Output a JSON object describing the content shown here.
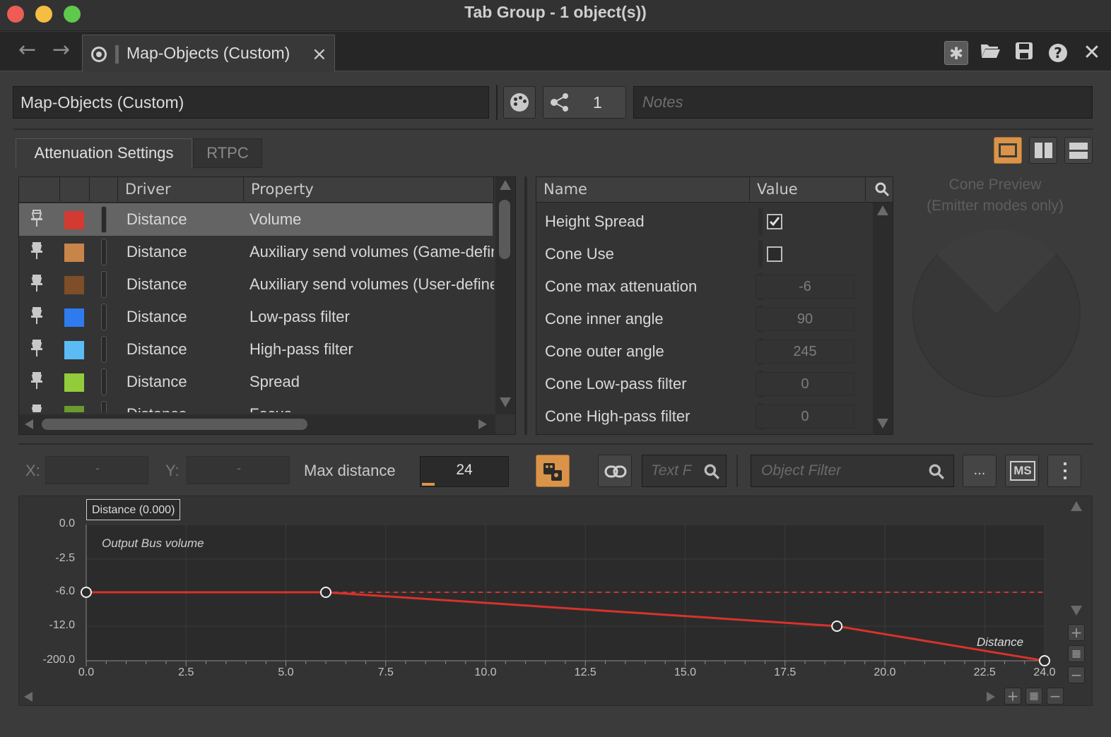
{
  "window": {
    "title": "Tab Group - 1 object(s))",
    "traffic_colors": [
      "#ee5c55",
      "#f5bd42",
      "#5ec94a"
    ]
  },
  "doc_tab": {
    "label": "Map-Objects (Custom)",
    "close": "×"
  },
  "object": {
    "name": "Map-Objects (Custom)",
    "share_count": "1",
    "notes_placeholder": "Notes"
  },
  "tabs": [
    {
      "label": "Attenuation Settings",
      "active": true
    },
    {
      "label": "RTPC",
      "active": false
    }
  ],
  "curve_table": {
    "columns": [
      "",
      "",
      "",
      "Driver",
      "Property"
    ],
    "rows": [
      {
        "driver": "Distance",
        "property": "Volume",
        "color": "#d33a32",
        "selected": true
      },
      {
        "driver": "Distance",
        "property": "Auxiliary send volumes (Game-defined)",
        "color": "#c8854a",
        "selected": false
      },
      {
        "driver": "Distance",
        "property": "Auxiliary send volumes (User-defined)",
        "color": "#7d4e27",
        "selected": false
      },
      {
        "driver": "Distance",
        "property": "Low-pass filter",
        "color": "#2e7bf0",
        "selected": false
      },
      {
        "driver": "Distance",
        "property": "High-pass filter",
        "color": "#5bbcf5",
        "selected": false
      },
      {
        "driver": "Distance",
        "property": "Spread",
        "color": "#93cc3b",
        "selected": false
      },
      {
        "driver": "Distance",
        "property": "Focus",
        "color": "#6b9a2e",
        "selected": false
      }
    ]
  },
  "properties": {
    "columns": [
      "Name",
      "Value"
    ],
    "rows": [
      {
        "name": "Height Spread",
        "type": "checkbox",
        "checked": true
      },
      {
        "name": "Cone Use",
        "type": "checkbox",
        "checked": false
      },
      {
        "name": "Cone max attenuation",
        "type": "value",
        "value": "-6"
      },
      {
        "name": "Cone inner angle",
        "type": "value",
        "value": "90"
      },
      {
        "name": "Cone outer angle",
        "type": "value",
        "value": "245"
      },
      {
        "name": "Cone Low-pass filter",
        "type": "value",
        "value": "0"
      },
      {
        "name": "Cone High-pass filter",
        "type": "value",
        "value": "0"
      }
    ]
  },
  "cone_preview": {
    "line1": "Cone Preview",
    "line2": "(Emitter modes only)"
  },
  "controls": {
    "x_label": "X:",
    "x_value": "-",
    "y_label": "Y:",
    "y_value": "-",
    "max_distance_label": "Max distance",
    "max_distance_value": "24",
    "text_filter_placeholder": "Text F",
    "object_filter_placeholder": "Object Filter",
    "more_label": "...",
    "ms_label": "MS"
  },
  "icons": {
    "back": "arrow-left-icon",
    "forward": "arrow-right-icon",
    "pin": "pin-icon",
    "search": "search-icon"
  },
  "chart_data": {
    "type": "line",
    "tooltip": "Distance (0.000)",
    "series_label": "Output Bus volume",
    "x_axis_label": "Distance",
    "x_ticks": [
      "0.0",
      "2.5",
      "5.0",
      "7.5",
      "10.0",
      "12.5",
      "15.0",
      "17.5",
      "20.0",
      "22.5",
      "24.0"
    ],
    "x_tick_values": [
      0,
      2.5,
      5,
      7.5,
      10,
      12.5,
      15,
      17.5,
      20,
      22.5,
      24
    ],
    "y_ticks": [
      "0.0",
      "-2.5",
      "-6.0",
      "-12.0",
      "-200.0"
    ],
    "xlim": [
      0,
      24
    ],
    "points": [
      {
        "x": 0,
        "y": "-6.0"
      },
      {
        "x": 6,
        "y": "-6.0"
      },
      {
        "x": 18.8,
        "y": "-12.0"
      },
      {
        "x": 24,
        "y": "-200.0"
      }
    ],
    "reference_line_y": "-6.0",
    "color": "#d7322c"
  }
}
